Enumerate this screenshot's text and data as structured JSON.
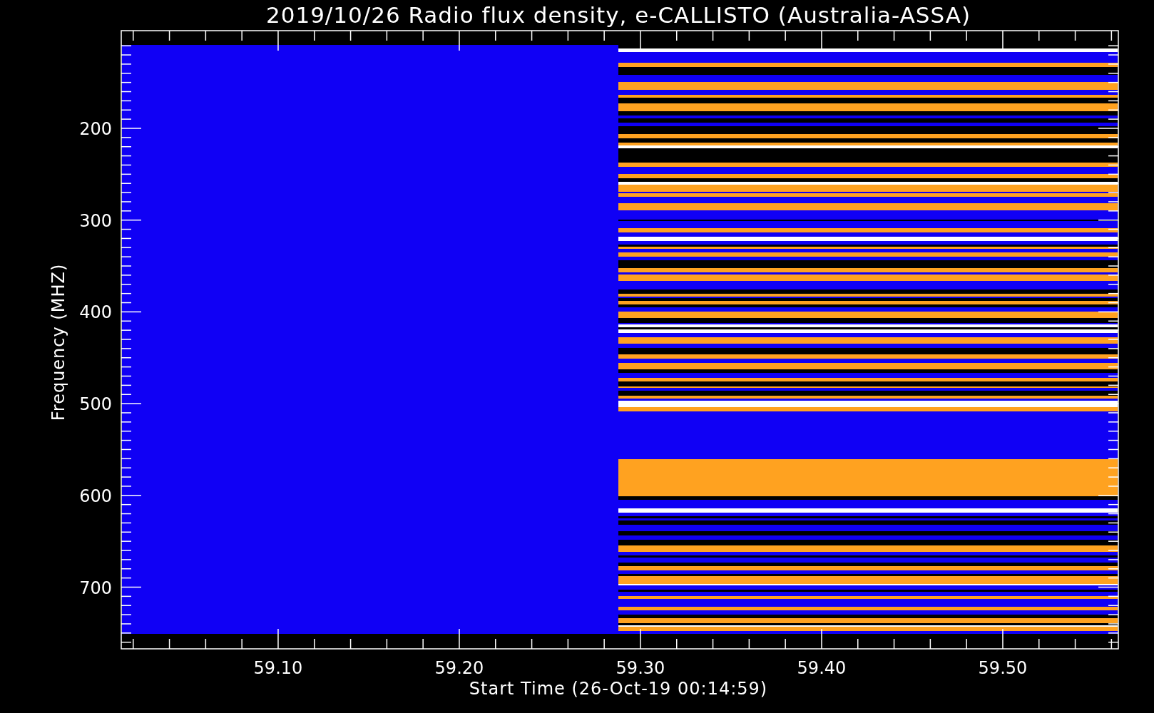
{
  "plot": {
    "title": "2019/10/26  Radio flux density, e-CALLISTO (Australia-ASSA)",
    "xlabel": "Start Time (26-Oct-19 00:14:59)",
    "ylabel": "Frequency (MHZ)",
    "xticks": [
      "59.10",
      "59.20",
      "59.30",
      "59.40",
      "59.50"
    ],
    "yticks": [
      "200",
      "300",
      "400",
      "500",
      "600",
      "700"
    ]
  }
}
